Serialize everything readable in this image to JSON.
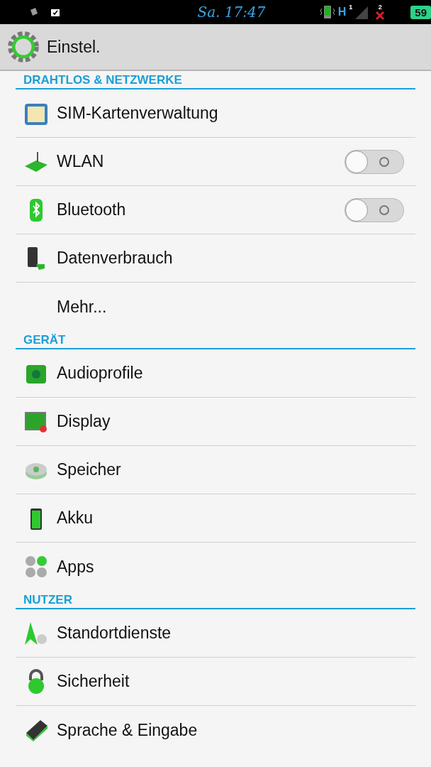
{
  "status_bar": {
    "time": "Sa. 17:47",
    "network": "H",
    "sim_1": "1",
    "sim_2": "2",
    "battery": "59"
  },
  "app_bar": {
    "title": "Einstel."
  },
  "sections": [
    {
      "title": "DRAHTLOS & NETZWERKE",
      "items": [
        {
          "kind": "plain",
          "label": "SIM-Kartenverwaltung"
        },
        {
          "kind": "toggle",
          "label": "WLAN",
          "on": false
        },
        {
          "kind": "toggle",
          "label": "Bluetooth",
          "on": false
        },
        {
          "kind": "plain",
          "label": "Datenverbrauch"
        },
        {
          "kind": "noicon",
          "label": "Mehr..."
        }
      ]
    },
    {
      "title": "GERÄT",
      "items": [
        {
          "kind": "plain",
          "label": "Audioprofile"
        },
        {
          "kind": "plain",
          "label": "Display"
        },
        {
          "kind": "plain",
          "label": "Speicher"
        },
        {
          "kind": "plain",
          "label": "Akku"
        },
        {
          "kind": "plain",
          "label": "Apps"
        }
      ]
    },
    {
      "title": "NUTZER",
      "items": [
        {
          "kind": "plain",
          "label": "Standortdienste"
        },
        {
          "kind": "plain",
          "label": "Sicherheit"
        },
        {
          "kind": "plain",
          "label": "Sprache & Eingabe"
        }
      ]
    }
  ]
}
